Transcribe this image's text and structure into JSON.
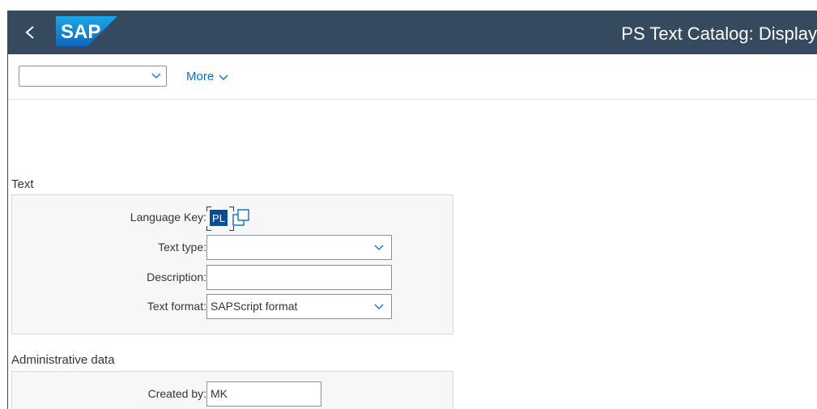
{
  "header": {
    "logo_text": "SAP",
    "title": "PS Text Catalog: Display"
  },
  "toolbar": {
    "variant_value": "",
    "more_label": "More"
  },
  "sections": {
    "text": {
      "title": "Text",
      "fields": {
        "language_key": {
          "label": "Language Key:",
          "value": "PL"
        },
        "text_type": {
          "label": "Text type:",
          "value": ""
        },
        "description": {
          "label": "Description:",
          "value": ""
        },
        "text_format": {
          "label": "Text format:",
          "value": "SAPScript format"
        }
      }
    },
    "admin": {
      "title": "Administrative data",
      "fields": {
        "created_by": {
          "label": "Created by:",
          "value": "MK"
        }
      }
    }
  },
  "colors": {
    "shell_bar": "#354a5f",
    "link": "#0a6ed1",
    "selection": "#0a4d96"
  },
  "icons": [
    "back-icon",
    "chevron-down-icon",
    "copy-icon"
  ]
}
